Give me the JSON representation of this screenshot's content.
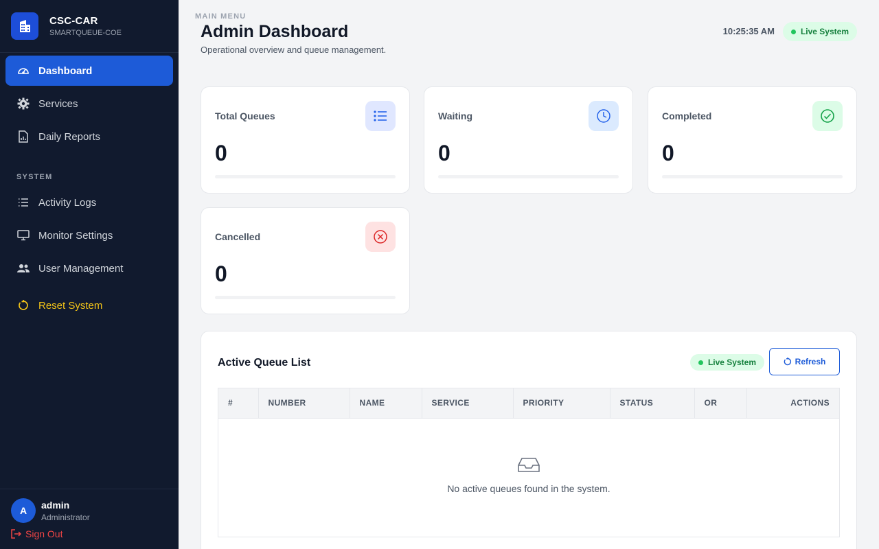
{
  "brand": {
    "name": "CSC-CAR",
    "subtitle": "SMARTQUEUE-COE",
    "logo_icon": "building-icon"
  },
  "sidebar": {
    "main_menu_heading": "MAIN MENU",
    "main_items": [
      {
        "label": "Dashboard",
        "icon": "dashboard-icon",
        "active": true
      },
      {
        "label": "Services",
        "icon": "gear-icon"
      },
      {
        "label": "Daily Reports",
        "icon": "report-icon"
      }
    ],
    "system_heading": "SYSTEM",
    "system_items": [
      {
        "label": "Activity Logs",
        "icon": "list-icon"
      },
      {
        "label": "Monitor Settings",
        "icon": "monitor-icon"
      },
      {
        "label": "User Management",
        "icon": "users-icon"
      }
    ],
    "reset_label": "Reset System"
  },
  "user": {
    "initial": "A",
    "name": "admin",
    "role": "Administrator",
    "signout_label": "Sign Out"
  },
  "header": {
    "title": "Admin Dashboard",
    "subtitle": "Operational overview and queue management.",
    "time": "10:25:35 AM",
    "live_label": "Live System"
  },
  "stats": [
    {
      "label": "Total Queues",
      "value": "0",
      "icon": "list-icon",
      "color": "#2563eb",
      "bg": "#e0e7ff"
    },
    {
      "label": "Waiting",
      "value": "0",
      "icon": "clock-icon",
      "color": "#2563eb",
      "bg": "#dbeafe"
    },
    {
      "label": "Completed",
      "value": "0",
      "icon": "check-circle-icon",
      "color": "#16a34a",
      "bg": "#dcfce7"
    },
    {
      "label": "Cancelled",
      "value": "0",
      "icon": "x-circle-icon",
      "color": "#dc2626",
      "bg": "#fee2e2"
    }
  ],
  "queue_panel": {
    "title": "Active Queue List",
    "live_label": "Live System",
    "refresh_label": "Refresh",
    "columns": [
      "#",
      "NUMBER",
      "NAME",
      "SERVICE",
      "PRIORITY",
      "STATUS",
      "OR",
      "ACTIONS"
    ],
    "empty_text": "No active queues found in the system.",
    "empty_icon": "inbox-icon"
  },
  "colors": {
    "sidebar_bg": "#111a2e",
    "accent": "#1d5bd8",
    "reset": "#f5c518",
    "signout": "#ef4444",
    "live_green": "#22c55e"
  }
}
